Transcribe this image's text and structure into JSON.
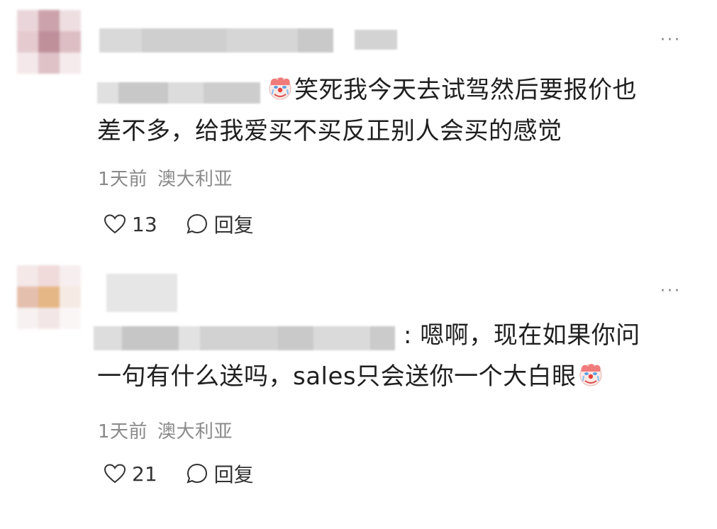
{
  "more_label": "···",
  "comments": [
    {
      "text_line1": "笑死我今天去试驾然后要报价也",
      "text_line2": "差不多，给我爱买不买反正别人会买的感觉",
      "time": "1天前",
      "location": "澳大利亚",
      "likes": "13",
      "reply_label": "回复"
    },
    {
      "text_line1": ": 嗯啊，现在如果你问",
      "text_line2": "一句有什么送吗，sales只会送你一个大白眼",
      "time": "1天前",
      "location": "澳大利亚",
      "likes": "21",
      "reply_label": "回复"
    }
  ],
  "colors": {
    "text": "#1f1f1f",
    "meta": "#8a8a8a",
    "icon": "#333333"
  },
  "icons": [
    "clown-face-emoji",
    "heart-outline-icon",
    "speech-bubble-icon",
    "more-icon"
  ]
}
